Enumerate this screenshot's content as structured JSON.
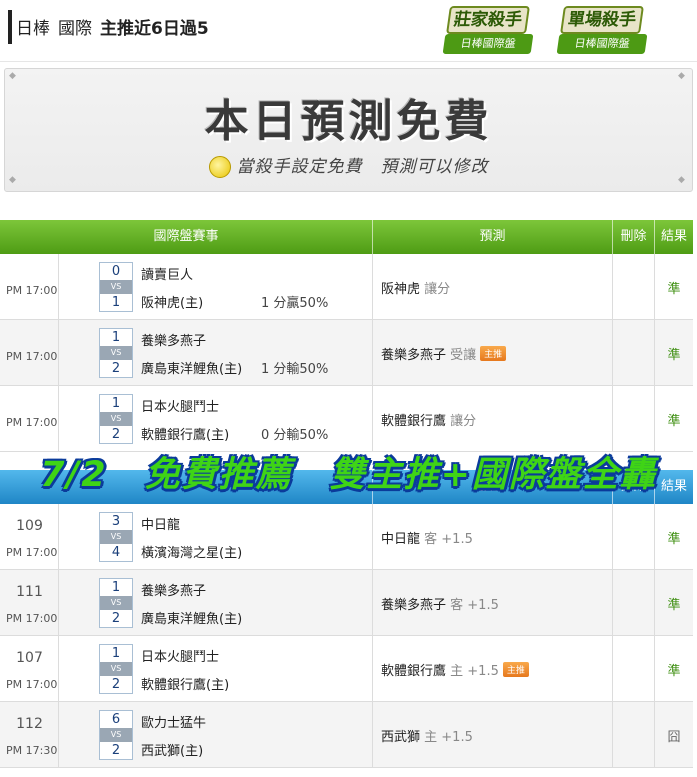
{
  "header": {
    "crumb1": "日棒",
    "crumb2": "國際",
    "headline": "主推近6日過5",
    "badges": [
      {
        "top": "莊家殺手",
        "bottom": "日棒國際盤"
      },
      {
        "top": "單場殺手",
        "bottom": "日棒國際盤"
      }
    ]
  },
  "promo": {
    "title": "本日預測免費",
    "subtitle": "當殺手設定免費　預測可以修改"
  },
  "table1": {
    "columns": [
      "國際盤賽事",
      "預測",
      "刪除",
      "結果"
    ],
    "rows": [
      {
        "time": "PM 17:00",
        "s1": "0",
        "s2": "1",
        "vs": "VS",
        "team1": "讀賣巨人",
        "team2": "阪神虎(主)",
        "handicap": "1 分贏50%",
        "pred_team": "阪神虎",
        "pred_note": "讓分",
        "tag": "",
        "result": "準"
      },
      {
        "time": "PM 17:00",
        "s1": "1",
        "s2": "2",
        "vs": "VS",
        "team1": "養樂多燕子",
        "team2": "廣島東洋鯉魚(主)",
        "handicap": "1 分輸50%",
        "pred_team": "養樂多燕子",
        "pred_note": "受讓",
        "tag": "主推",
        "result": "準"
      },
      {
        "time": "PM 17:00",
        "s1": "1",
        "s2": "2",
        "vs": "VS",
        "team1": "日本火腿鬥士",
        "team2": "軟體銀行鷹(主)",
        "handicap": "0 分輸50%",
        "pred_team": "軟體銀行鷹",
        "pred_note": "讓分",
        "tag": "",
        "result": "準"
      }
    ]
  },
  "banner": "7/2　免費推薦　雙主推+國際盤全轟",
  "table2": {
    "columns": [
      "預測",
      "刪除",
      "結果"
    ],
    "rows": [
      {
        "num": "109",
        "time": "PM 17:00",
        "s1": "3",
        "s2": "4",
        "vs": "VS",
        "team1": "中日龍",
        "team2": "橫濱海灣之星(主)",
        "pred_team": "中日龍",
        "pred_note": "客 +1.5",
        "tag": "",
        "result": "準"
      },
      {
        "num": "111",
        "time": "PM 17:00",
        "s1": "1",
        "s2": "2",
        "vs": "VS",
        "team1": "養樂多燕子",
        "team2": "廣島東洋鯉魚(主)",
        "pred_team": "養樂多燕子",
        "pred_note": "客 +1.5",
        "tag": "",
        "result": "準"
      },
      {
        "num": "107",
        "time": "PM 17:00",
        "s1": "1",
        "s2": "2",
        "vs": "VS",
        "team1": "日本火腿鬥士",
        "team2": "軟體銀行鷹(主)",
        "pred_team": "軟體銀行鷹",
        "pred_note": "主 +1.5",
        "tag": "主推",
        "result": "準"
      },
      {
        "num": "112",
        "time": "PM 17:30",
        "s1": "6",
        "s2": "2",
        "vs": "VS",
        "team1": "歐力士猛牛",
        "team2": "西武獅(主)",
        "pred_team": "西武獅",
        "pred_note": "主 +1.5",
        "tag": "",
        "result": "囧"
      }
    ]
  }
}
